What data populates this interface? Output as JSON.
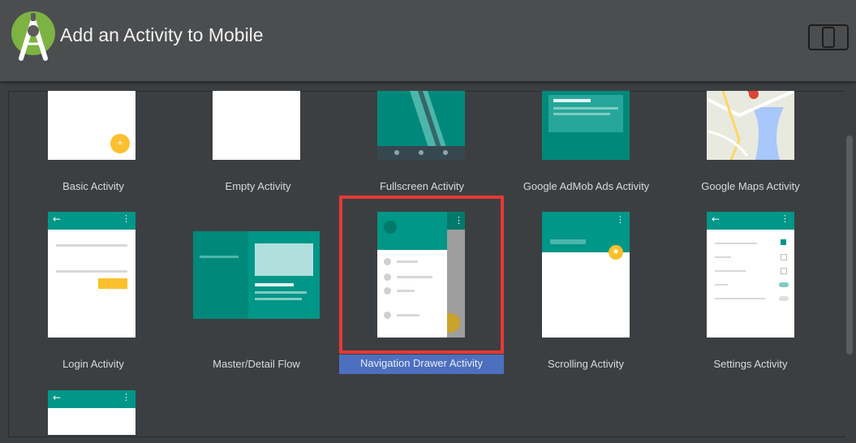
{
  "window": {
    "title": "Add an Activity to Mobile"
  },
  "activities": [
    {
      "label": "Basic Activity"
    },
    {
      "label": "Empty Activity"
    },
    {
      "label": "Fullscreen Activity"
    },
    {
      "label": "Google AdMob Ads Activity"
    },
    {
      "label": "Google Maps Activity"
    },
    {
      "label": "Login Activity"
    },
    {
      "label": "Master/Detail Flow"
    },
    {
      "label": "Navigation Drawer Activity",
      "selected": true
    },
    {
      "label": "Scrolling Activity"
    },
    {
      "label": "Settings Activity"
    },
    {
      "label": ""
    }
  ],
  "colors": {
    "accent_teal": "#009688",
    "fab_yellow": "#fbc02d",
    "selection_blue": "#4c6fbf",
    "highlight_red": "#e53935"
  },
  "icons": {
    "app_logo": "android-studio-icon",
    "device": "phone-tablet-icon"
  }
}
